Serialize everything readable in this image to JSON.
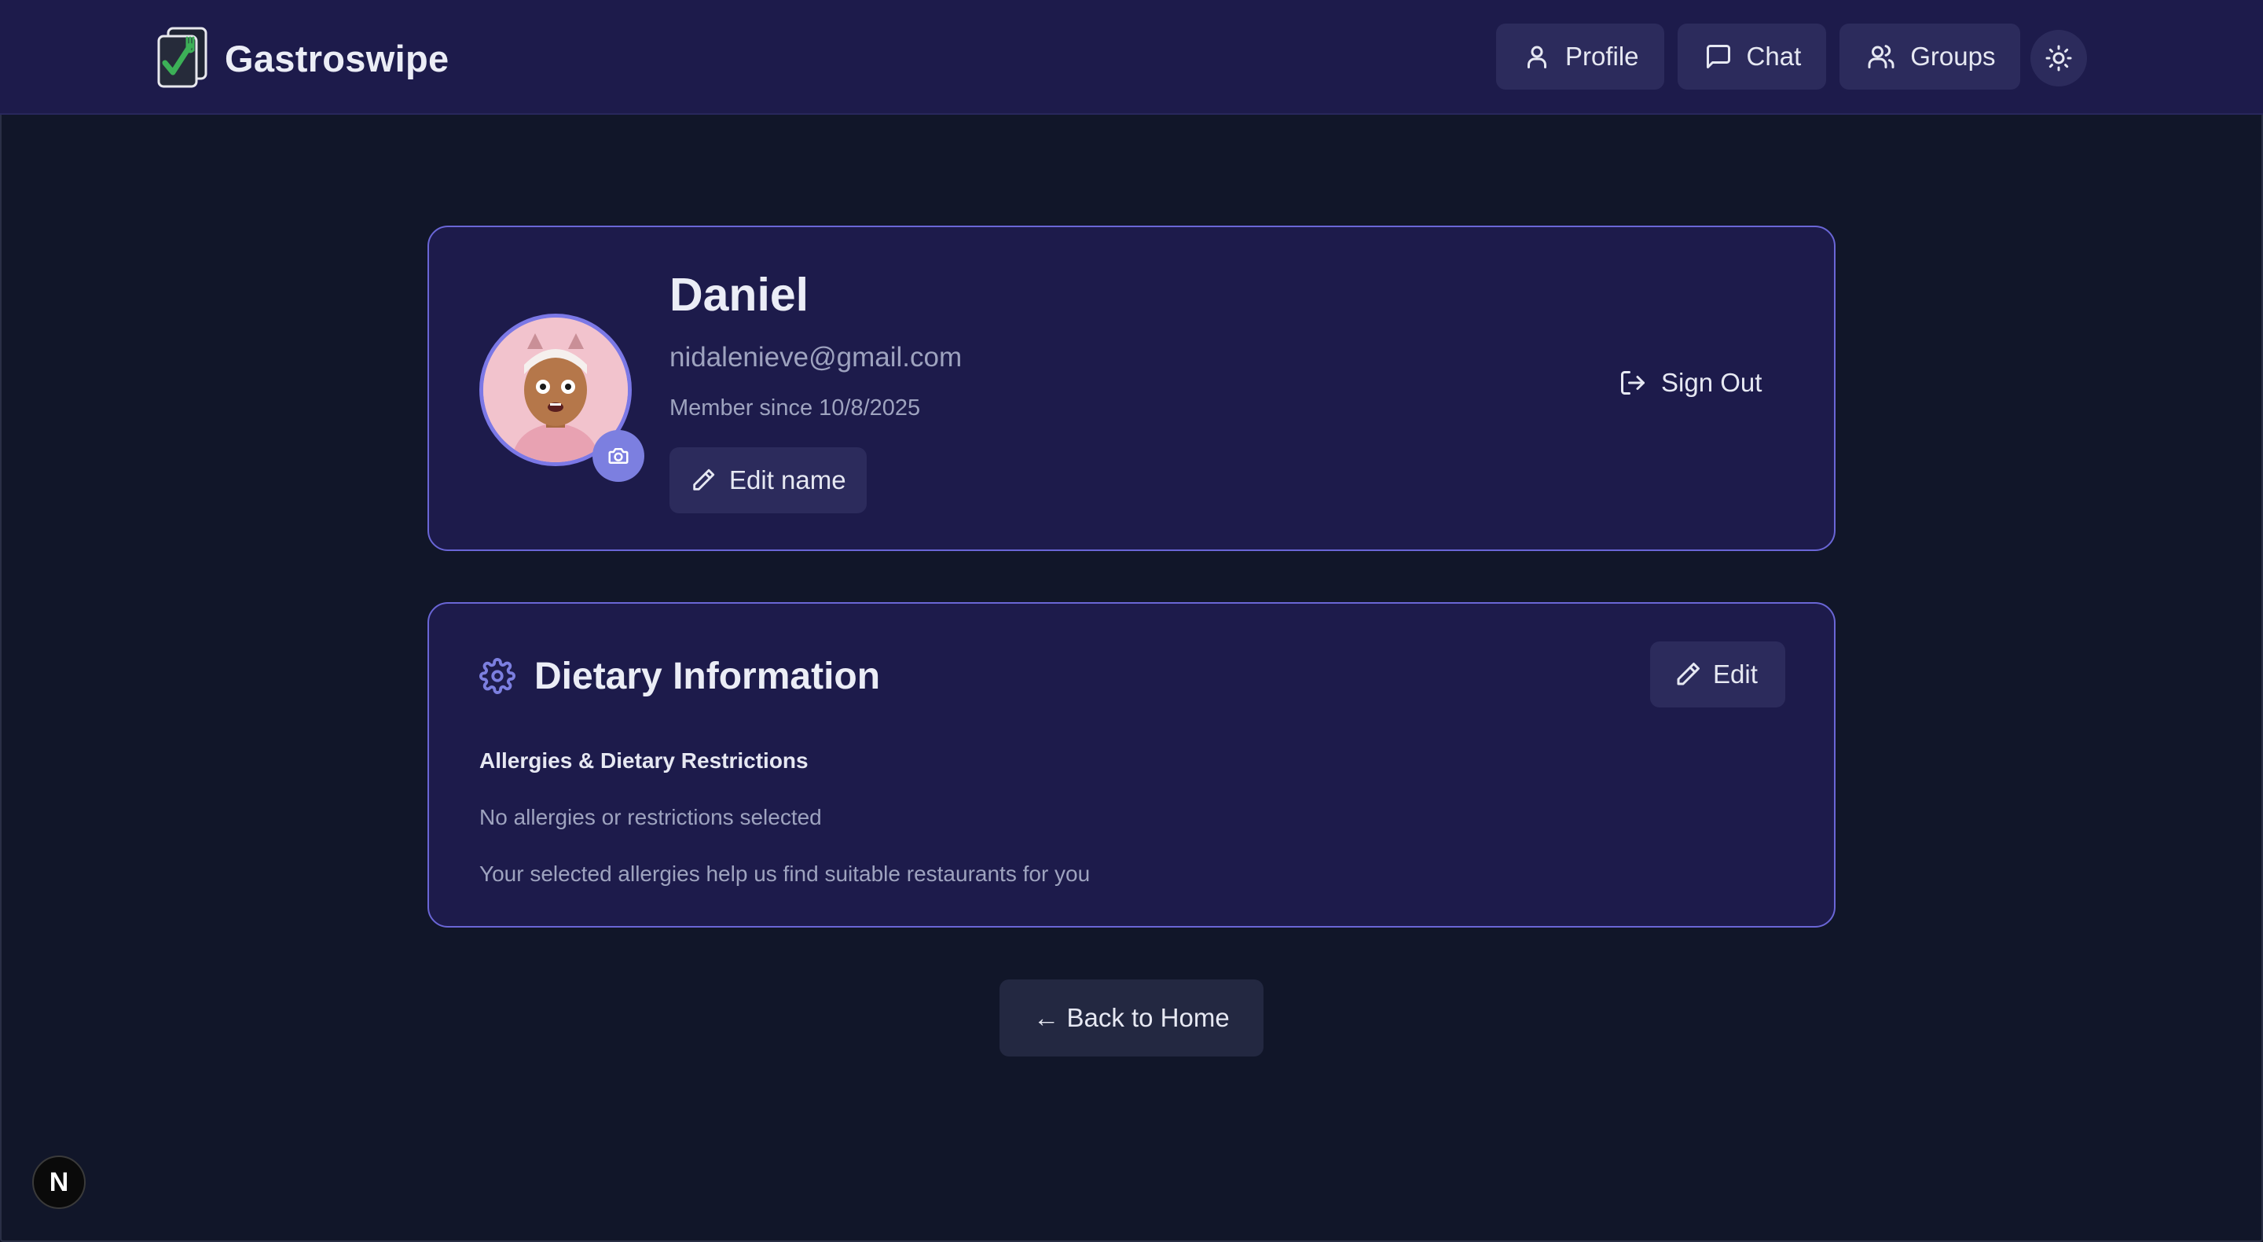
{
  "app": {
    "name": "Gastroswipe"
  },
  "nav": {
    "profile": "Profile",
    "chat": "Chat",
    "groups": "Groups",
    "theme_icon": "sun-icon"
  },
  "profile": {
    "name": "Daniel",
    "email": "nidalenieve@gmail.com",
    "member_since": "Member since 10/8/2025",
    "edit_name_label": "Edit name",
    "sign_out_label": "Sign Out",
    "avatar_icon": "avatar-cartoon",
    "camera_icon": "camera-icon"
  },
  "dietary": {
    "title": "Dietary Information",
    "edit_label": "Edit",
    "subheading": "Allergies & Dietary Restrictions",
    "empty_text": "No allergies or restrictions selected",
    "help_text": "Your selected allergies help us find suitable restaurants for you",
    "icon": "gear-icon"
  },
  "back_home_label": "← Back to Home",
  "dev_badge": "N",
  "colors": {
    "background": "#111629",
    "header": "#1d1b4b",
    "card": "#1d1b4b",
    "card_border": "#6a66d6",
    "button": "#2c2b5c",
    "accent": "#7c7fe0"
  }
}
